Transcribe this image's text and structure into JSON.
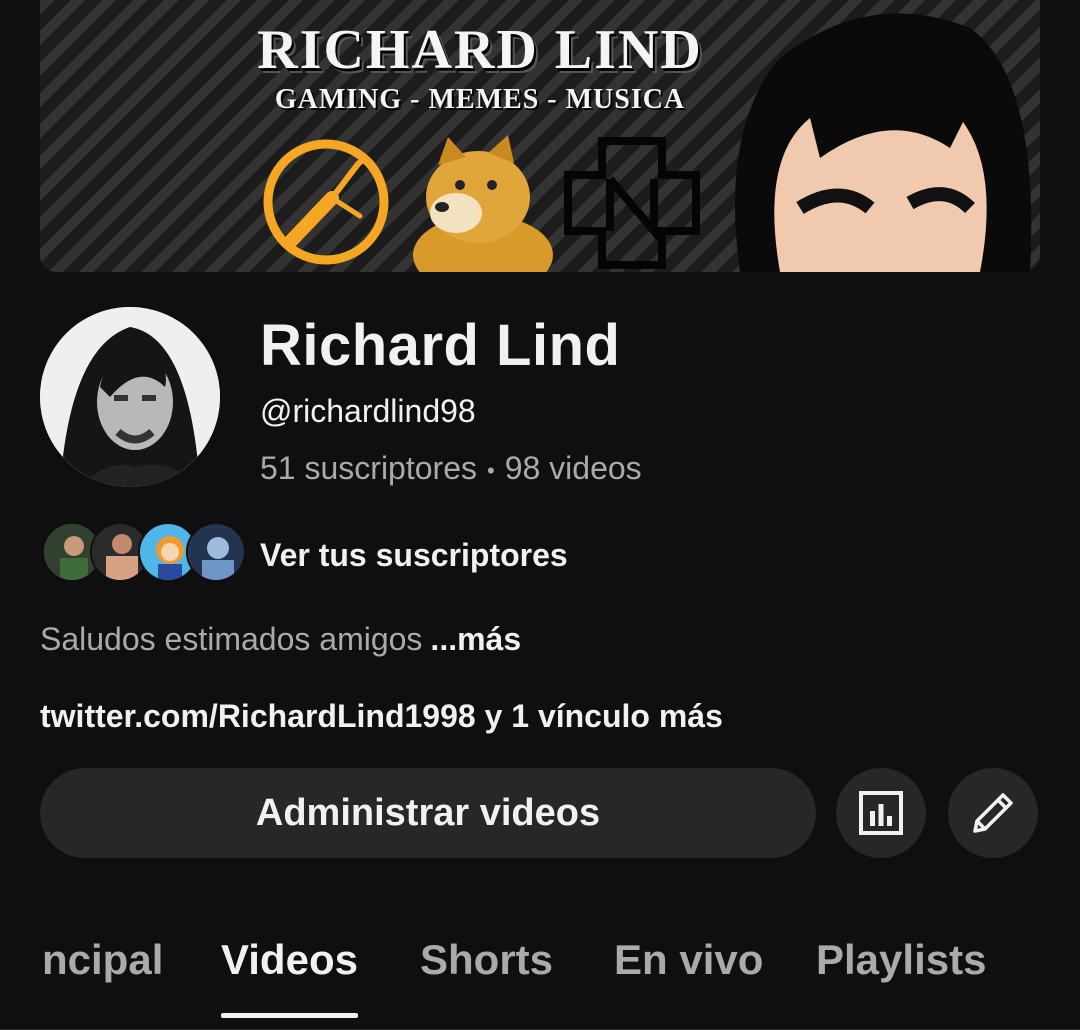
{
  "banner": {
    "title": "RICHARD LIND",
    "subtitle": "GAMING - MEMES - MUSICA"
  },
  "channel": {
    "name": "Richard Lind",
    "handle": "@richardlind98",
    "subscribers": "51 suscriptores",
    "separator": "•",
    "videos": "98 videos"
  },
  "subscribers_link": "Ver tus suscriptores",
  "description": {
    "text": "Saludos estimados amigos",
    "more": "...más"
  },
  "links": "twitter.com/RichardLind1998 y 1 vínculo más",
  "actions": {
    "manage_label": "Administrar videos",
    "analytics_icon": "analytics-icon",
    "edit_icon": "pencil-icon"
  },
  "tabs": [
    {
      "label": "ncipal",
      "active": false
    },
    {
      "label": "Videos",
      "active": true
    },
    {
      "label": "Shorts",
      "active": false
    },
    {
      "label": "En vivo",
      "active": false
    },
    {
      "label": "Playlists",
      "active": false
    }
  ],
  "colors": {
    "background": "#0f0f0f",
    "surface": "#272727",
    "text_primary": "#f1f1f1",
    "text_secondary": "#aaaaaa",
    "halflife_orange": "#f5a623"
  }
}
